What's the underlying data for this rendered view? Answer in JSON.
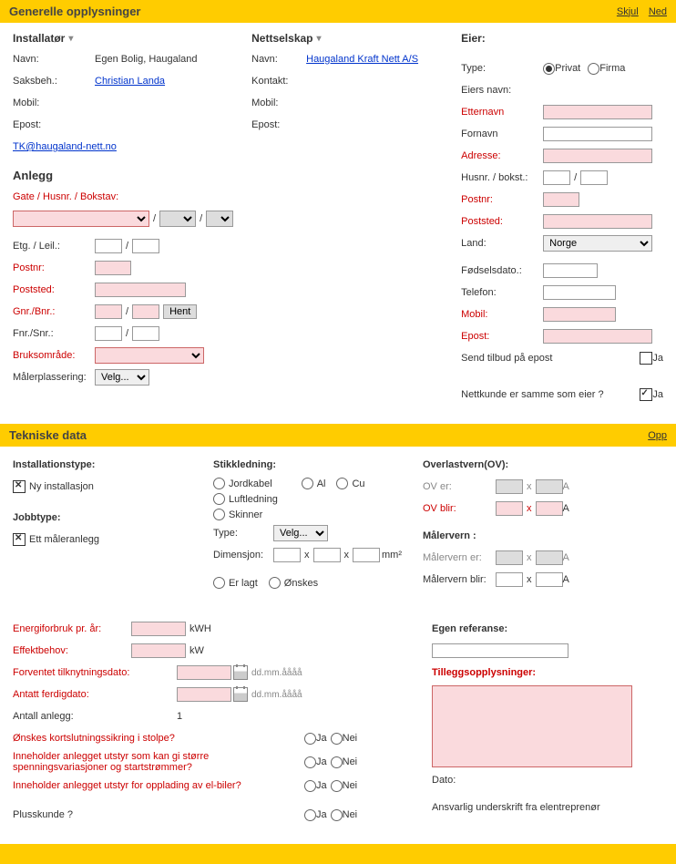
{
  "sections": {
    "general": {
      "title": "Generelle opplysninger",
      "skjul": "Skjul",
      "ned": "Ned"
    },
    "tech": {
      "title": "Tekniske data",
      "opp": "Opp"
    }
  },
  "installer": {
    "header": "Installatør",
    "name_label": "Navn:",
    "name_value": "Egen Bolig, Haugaland",
    "saksbeh_label": "Saksbeh.:",
    "saksbeh_value": "Christian Landa",
    "mobil_label": "Mobil:",
    "epost_label": "Epost:",
    "email_link": "TK@haugaland-nett.no"
  },
  "nettselskap": {
    "header": "Nettselskap",
    "name_label": "Navn:",
    "name_value": "Haugaland Kraft Nett A/S",
    "kontakt_label": "Kontakt:",
    "mobil_label": "Mobil:",
    "epost_label": "Epost:"
  },
  "anlegg": {
    "header": "Anlegg",
    "gate_label": "Gate / Husnr. / Bokstav:",
    "etg_label": "Etg. / Leil.:",
    "postnr_label": "Postnr:",
    "poststed_label": "Poststed:",
    "gnr_label": "Gnr./Bnr.:",
    "hent_btn": "Hent",
    "fnr_label": "Fnr./Snr.:",
    "bruks_label": "Bruksområde:",
    "maler_label": "Målerplassering:",
    "velg": "Velg..."
  },
  "eier": {
    "header": "Eier:",
    "type_label": "Type:",
    "privat": "Privat",
    "firma": "Firma",
    "eiers_navn_label": "Eiers navn:",
    "etternavn_label": "Etternavn",
    "fornavn_label": "Fornavn",
    "adresse_label": "Adresse:",
    "husnr_label": "Husnr. / bokst.:",
    "postnr_label": "Postnr:",
    "poststed_label": "Poststed:",
    "land_label": "Land:",
    "land_value": "Norge",
    "fodsel_label": "Fødselsdato.:",
    "telefon_label": "Telefon:",
    "mobil_label": "Mobil:",
    "epost_label": "Epost:",
    "send_tilbud_label": "Send tilbud på epost",
    "ja": "Ja",
    "nettkunde_label": "Nettkunde er samme som eier ?"
  },
  "tech": {
    "install_type_label": "Installationstype:",
    "ny_install": "Ny installasjon",
    "jobb_type_label": "Jobbtype:",
    "ett_maler": "Ett måleranlegg",
    "stikkledning_label": "Stikkledning:",
    "jordkabel": "Jordkabel",
    "al": "Al",
    "cu": "Cu",
    "luftledning": "Luftledning",
    "skinner": "Skinner",
    "type_label": "Type:",
    "velg": "Velg...",
    "dimensjon_label": "Dimensjon:",
    "mm2": "mm²",
    "er_lagt": "Er lagt",
    "onskes": "Ønskes",
    "overlast_label": "Overlastvern(OV):",
    "ov_er_label": "OV er:",
    "ov_blir_label": "OV blir:",
    "malervern_label": "Målervern :",
    "malervern_er_label": "Målervern er:",
    "malervern_blir_label": "Målervern blir:",
    "x": "x",
    "A": "A",
    "energi_label": "Energiforbruk pr. år:",
    "kwh": "kWH",
    "effekt_label": "Effektbehov:",
    "kw": "kW",
    "forventet_label": "Forventet tilknytningsdato:",
    "antatt_label": "Antatt ferdigdato:",
    "date_hint": "dd.mm.åååå",
    "antall_label": "Antall anlegg:",
    "antall_value": "1",
    "kortslut_label": "Ønskes kortslutningssikring i stolpe?",
    "spenning_label": "Inneholder anlegget utstyr som kan gi større spenningsvariasjoner og startstrømmer?",
    "elbil_label": "Inneholder anlegget utstyr for opplading av el-biler?",
    "pluss_label": "Plusskunde ?",
    "ja": "Ja",
    "nei": "Nei",
    "egen_ref_label": "Egen referanse:",
    "tillegs_label": "Tilleggsopplysninger:",
    "dato_label": "Dato:",
    "ansvarlig_label": "Ansvarlig underskrift fra elentreprenør"
  }
}
